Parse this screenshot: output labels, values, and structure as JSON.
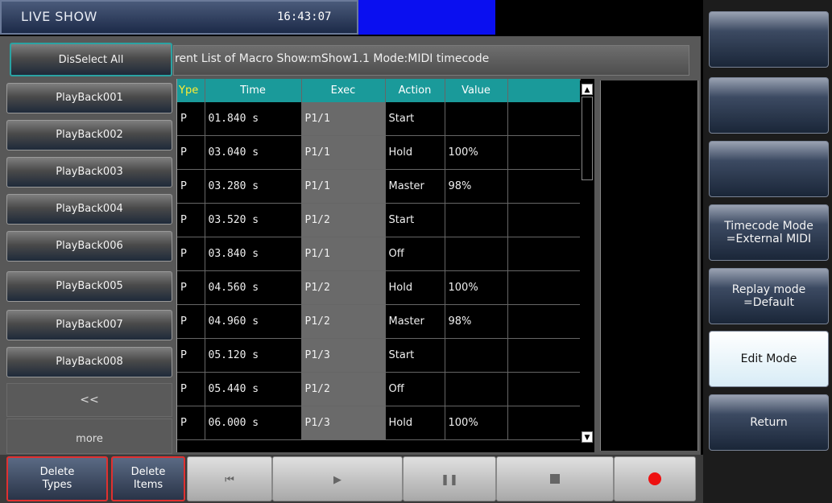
{
  "header": {
    "title": "LIVE SHOW",
    "clock": "16:43:07"
  },
  "info_text": "rent List of Macro Show:mShow1.1  Mode:MIDI timecode",
  "deselect_label": "DisSelect All",
  "playbacks": [
    "PlayBack001",
    "PlayBack002",
    "PlayBack003",
    "PlayBack004",
    "PlayBack006",
    "PlayBack005",
    "PlayBack007",
    "PlayBack008"
  ],
  "prev_label": "<<",
  "more_label": "more",
  "table": {
    "headers": [
      "Type",
      "Time",
      "Exec",
      "Action",
      "Value"
    ],
    "rows": [
      [
        "P",
        "01.840 s",
        "P1/1",
        "Start",
        ""
      ],
      [
        "P",
        "03.040 s",
        "P1/1",
        "Hold",
        "100%"
      ],
      [
        "P",
        "03.280 s",
        "P1/1",
        "Master",
        "98%"
      ],
      [
        "P",
        "03.520 s",
        "P1/2",
        "Start",
        ""
      ],
      [
        "P",
        "03.840 s",
        "P1/1",
        "Off",
        ""
      ],
      [
        "P",
        "04.560 s",
        "P1/2",
        "Hold",
        "100%"
      ],
      [
        "P",
        "04.960 s",
        "P1/2",
        "Master",
        "98%"
      ],
      [
        "P",
        "05.120 s",
        "P1/3",
        "Start",
        ""
      ],
      [
        "P",
        "05.440 s",
        "P1/2",
        "Off",
        ""
      ],
      [
        "P",
        "06.000 s",
        "P1/3",
        "Hold",
        "100%"
      ]
    ]
  },
  "right_buttons": [
    {
      "line1": "",
      "line2": ""
    },
    {
      "line1": "",
      "line2": ""
    },
    {
      "line1": "",
      "line2": ""
    },
    {
      "line1": "Timecode Mode",
      "line2": "=External MIDI"
    },
    {
      "line1": "Replay mode",
      "line2": "=Default"
    },
    {
      "line1": "Edit Mode",
      "line2": ""
    },
    {
      "line1": "Return",
      "line2": ""
    }
  ],
  "bottom": {
    "delete_types": [
      "Delete",
      "Types"
    ],
    "delete_items": [
      "Delete",
      "Items"
    ],
    "icons": [
      "skip-back-icon",
      "play-icon",
      "pause-icon",
      "stop-icon",
      "record-icon"
    ]
  },
  "colors": {
    "accent_teal": "#1a9a9a",
    "clock_bar": "#0a0ff0",
    "record": "#ee1111"
  }
}
